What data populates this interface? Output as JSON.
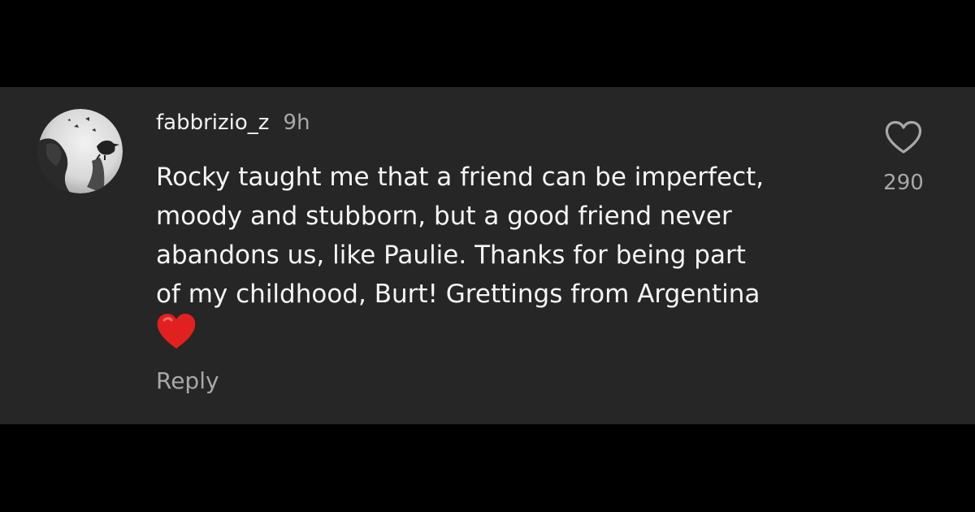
{
  "comment": {
    "username": "fabbrizio_z",
    "timestamp": "9h",
    "text": "Rocky taught me that a friend can be imperfect,\nmoody and stubborn, but a good friend never\nabandons us, like Paulie. Thanks for being part\nof my childhood, Burt! Grettings from Argentina",
    "emoji": "red-heart-emoji",
    "reply_label": "Reply",
    "like_count": "290",
    "avatar": "crow-avatar"
  },
  "colors": {
    "page_background": "#000000",
    "card_background": "#262626",
    "primary_text": "#f5f5f5",
    "secondary_text": "#a8a8a8",
    "heart_emoji": "#e0211f"
  },
  "icons": {
    "like": "heart-outline-icon"
  }
}
